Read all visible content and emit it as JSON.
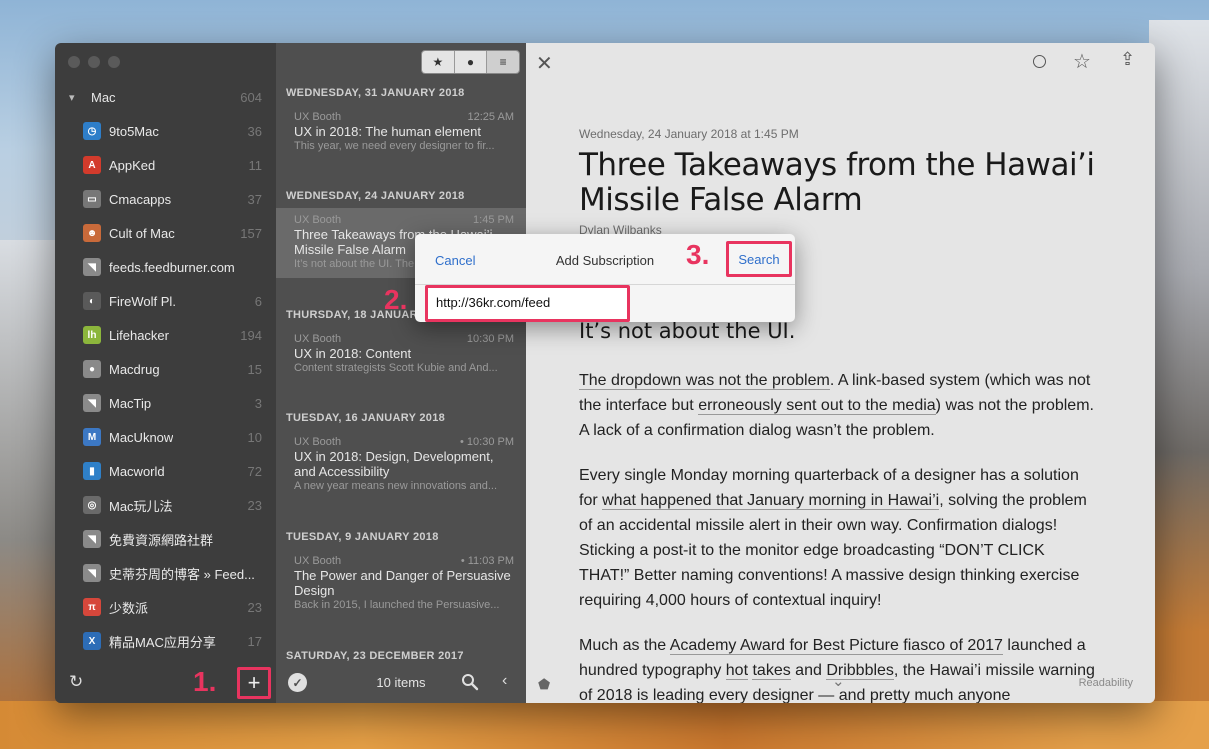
{
  "sidebar": {
    "group": {
      "name": "Mac",
      "count": "604"
    },
    "feeds": [
      {
        "label": "9to5Mac",
        "count": "36",
        "icon": "clock-icon",
        "color": "#2e7ec9",
        "glyph": "◷"
      },
      {
        "label": "AppKed",
        "count": "11",
        "icon": "appked-icon",
        "color": "#d33b2c",
        "glyph": "A"
      },
      {
        "label": "Cmacapps",
        "count": "37",
        "icon": "monitor-icon",
        "color": "#777777",
        "glyph": "▭"
      },
      {
        "label": "Cult of Mac",
        "count": "157",
        "icon": "cultofmac-icon",
        "color": "#c96a3a",
        "glyph": "☻"
      },
      {
        "label": "feeds.feedburner.com",
        "count": "",
        "icon": "rss-icon",
        "color": "#8a8a8a",
        "glyph": "◥"
      },
      {
        "label": "FireWolf Pl.",
        "count": "6",
        "icon": "firewolf-icon",
        "color": "#5a5a5a",
        "glyph": "◐"
      },
      {
        "label": "Lifehacker",
        "count": "194",
        "icon": "lifehacker-icon",
        "color": "#8cb63c",
        "glyph": "lh"
      },
      {
        "label": "Macdrug",
        "count": "15",
        "icon": "apple-icon",
        "color": "#8a8a8a",
        "glyph": "●"
      },
      {
        "label": "MacTip",
        "count": "3",
        "icon": "rss-icon",
        "color": "#8a8a8a",
        "glyph": "◥"
      },
      {
        "label": "MacUknow",
        "count": "10",
        "icon": "macuknow-icon",
        "color": "#3c78c4",
        "glyph": "M"
      },
      {
        "label": "Macworld",
        "count": "72",
        "icon": "macworld-icon",
        "color": "#2f80c8",
        "glyph": "▮"
      },
      {
        "label": "Mac玩儿法",
        "count": "23",
        "icon": "macwanerfa-icon",
        "color": "#6a6a6a",
        "glyph": "◎"
      },
      {
        "label": "免費資源網路社群",
        "count": "",
        "icon": "rss-icon",
        "color": "#8a8a8a",
        "glyph": "◥"
      },
      {
        "label": "史蒂芬周的博客 » Feed...",
        "count": "",
        "icon": "rss-icon",
        "color": "#8a8a8a",
        "glyph": "◥"
      },
      {
        "label": "少数派",
        "count": "23",
        "icon": "sspai-icon",
        "color": "#d6473b",
        "glyph": "π"
      },
      {
        "label": "精品MAC应用分享",
        "count": "17",
        "icon": "xclient-icon",
        "color": "#2d6db7",
        "glyph": "X"
      }
    ],
    "footer": {
      "step1": "1.",
      "add_label": "+"
    }
  },
  "list": {
    "segments": [
      "★",
      "●",
      "≡"
    ],
    "days": [
      "WEDNESDAY, 31 JANUARY 2018",
      "WEDNESDAY, 24 JANUARY 2018",
      "THURSDAY, 18 JANUARY 2018",
      "TUESDAY, 16 JANUARY 2018",
      "TUESDAY, 9 JANUARY 2018",
      "SATURDAY, 23 DECEMBER 2017"
    ],
    "entries": [
      {
        "source": "UX Booth",
        "time": "12:25 AM",
        "title": "UX in 2018: The human element",
        "summary": "This year, we need every designer to fir..."
      },
      {
        "source": "UX Booth",
        "time": "1:45 PM",
        "title": "Three Takeaways from the Hawai’i Missile False Alarm",
        "summary": "It’s not about the UI. The dro..."
      },
      {
        "source": "UX Booth",
        "time": "10:30 PM",
        "title": "UX in 2018: Content",
        "summary": "Content strategists Scott Kubie and And..."
      },
      {
        "source": "UX Booth",
        "time": "• 10:30 PM",
        "title": "UX in 2018: Design, Development, and Accessibility",
        "summary": "A new year means new innovations and..."
      },
      {
        "source": "UX Booth",
        "time": "• 11:03 PM",
        "title": "The Power and Danger of Persuasive Design",
        "summary": "Back in 2015, I launched the Persuasive..."
      }
    ],
    "footer": {
      "count": "10 items"
    }
  },
  "reader": {
    "meta": "Wednesday, 24 January 2018 at 1:45 PM",
    "headline": "Three Takeaways from the Hawai’i Missile False Alarm",
    "author": "Dylan Wilbanks",
    "subhead": "It’s not about the UI.",
    "p1": {
      "link1": "The dropdown was not the problem",
      "t1": ". A link-based system (which was not the interface but ",
      "link2": "erroneously sent out to the media",
      "t2": ") was not the problem. A lack of a confirmation dialog wasn’t the problem."
    },
    "p2": {
      "t1": "Every single Monday morning quarterback of a designer has a solution for ",
      "link1": "what happened that January morning in Hawai’i",
      "t2": ", solving the problem of an accidental missile alert in their own way. Confirmation dialogs! Sticking a post-it to the monitor edge broadcasting “DON’T CLICK THAT!” Better naming conventions! A massive design thinking exercise requiring 4,000 hours of contextual inquiry!"
    },
    "p3": {
      "t1": "Much as the ",
      "link1": "Academy Award for Best Picture fiasco of 2017",
      "t2": " launched a hundred typography ",
      "link2": "hot",
      "t3": " ",
      "link3": "takes",
      "t4": " and ",
      "link4": "Dribbbles",
      "t5": ", the Hawai’i missile warning of 2018 is leading every designer — and pretty much anyone"
    },
    "footer": {
      "readability": "Readability"
    }
  },
  "popover": {
    "cancel": "Cancel",
    "title": "Add Subscription",
    "search": "Search",
    "url_value": "http://36kr.com/feed",
    "step2": "2.",
    "step3": "3."
  }
}
